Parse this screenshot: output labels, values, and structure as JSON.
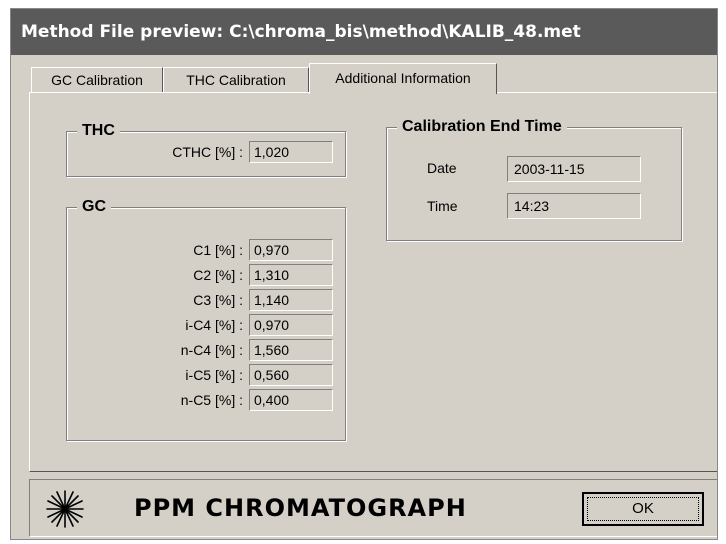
{
  "window": {
    "title": "Method File preview: C:\\chroma_bis\\method\\KALIB_48.met"
  },
  "tabs": [
    {
      "label": "GC Calibration"
    },
    {
      "label": "THC Calibration"
    },
    {
      "label": "Additional Information",
      "active": true
    }
  ],
  "thc": {
    "title": "THC",
    "rows": [
      {
        "label": "CTHC [%] :",
        "value": "1,020"
      }
    ]
  },
  "gc": {
    "title": "GC",
    "rows": [
      {
        "label": "C1 [%] :",
        "value": "0,970"
      },
      {
        "label": "C2 [%] :",
        "value": "1,310"
      },
      {
        "label": "C3 [%] :",
        "value": "1,140"
      },
      {
        "label": "i-C4 [%] :",
        "value": "0,970"
      },
      {
        "label": "n-C4 [%] :",
        "value": "1,560"
      },
      {
        "label": "i-C5 [%] :",
        "value": "0,560"
      },
      {
        "label": "n-C5 [%] :",
        "value": "0,400"
      }
    ]
  },
  "calibration_end": {
    "title": "Calibration End Time",
    "date_label": "Date",
    "date_value": "2003-11-15",
    "time_label": "Time",
    "time_value": "14:23"
  },
  "footer": {
    "logo_icon": "starburst-icon",
    "brand": "PPM CHROMATOGRAPH",
    "ok_label": "OK"
  }
}
